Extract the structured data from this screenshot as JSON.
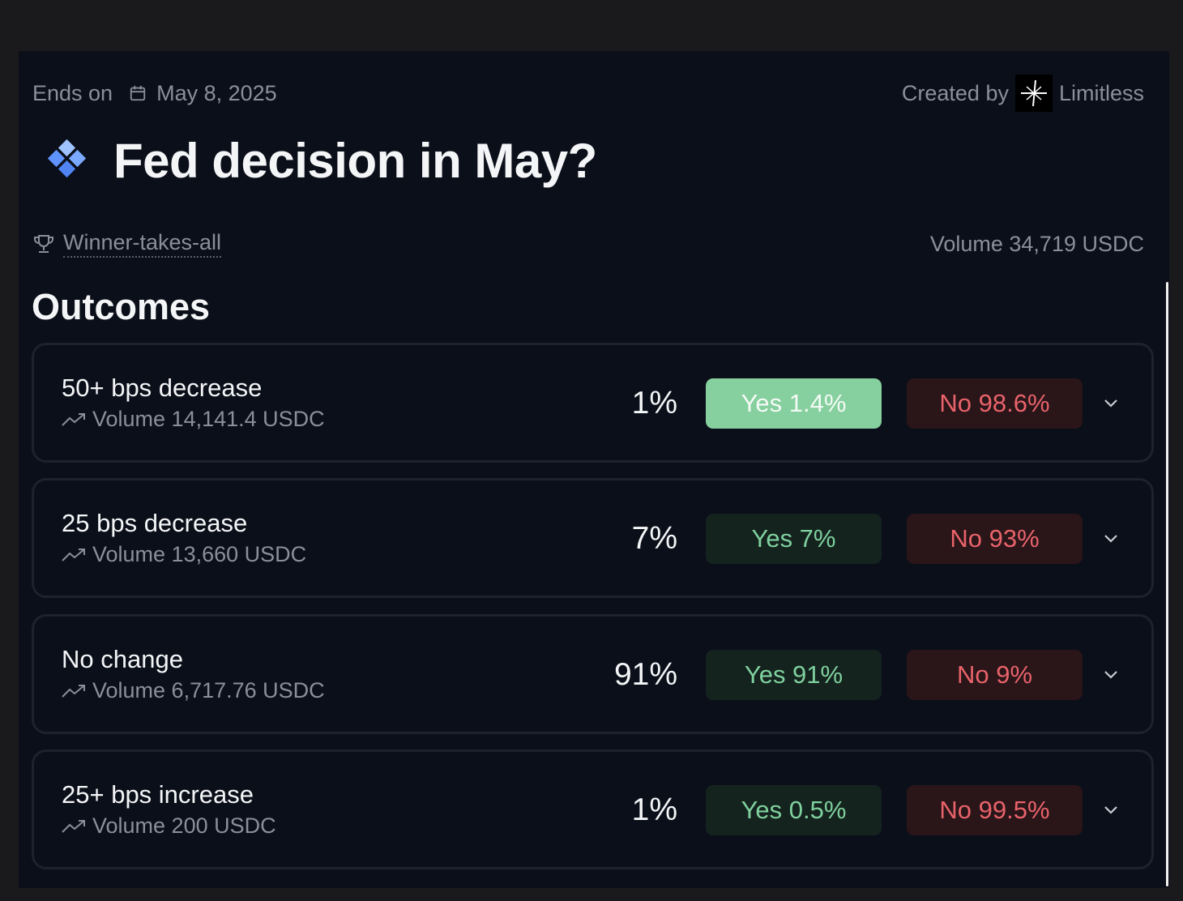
{
  "header": {
    "ends_label": "Ends on",
    "ends_date": "May 8, 2025",
    "created_label": "Created by",
    "creator": "Limitless"
  },
  "market": {
    "title": "Fed decision in May?",
    "type_label": "Winner-takes-all",
    "volume": "Volume 34,719 USDC"
  },
  "outcomes_title": "Outcomes",
  "outcomes": [
    {
      "name": "50+ bps decrease",
      "volume": "Volume 14,141.4 USDC",
      "pct": "1%",
      "yes": "Yes 1.4%",
      "no": "No 98.6%"
    },
    {
      "name": "25 bps decrease",
      "volume": "Volume 13,660 USDC",
      "pct": "7%",
      "yes": "Yes 7%",
      "no": "No 93%"
    },
    {
      "name": "No change",
      "volume": "Volume 6,717.76 USDC",
      "pct": "91%",
      "yes": "Yes 91%",
      "no": "No 9%"
    },
    {
      "name": "25+ bps increase",
      "volume": "Volume 200 USDC",
      "pct": "1%",
      "yes": "Yes 0.5%",
      "no": "No 99.5%"
    }
  ],
  "colors": {
    "background": "#0b0f19",
    "yes_active": "#86cf9e",
    "yes_text": "#7fd19e",
    "no_text": "#e8636a"
  },
  "icons": [
    "calendar-icon",
    "limitless-logo-icon",
    "diamond-icon",
    "trophy-icon",
    "trend-up-icon",
    "chevron-down-icon"
  ]
}
